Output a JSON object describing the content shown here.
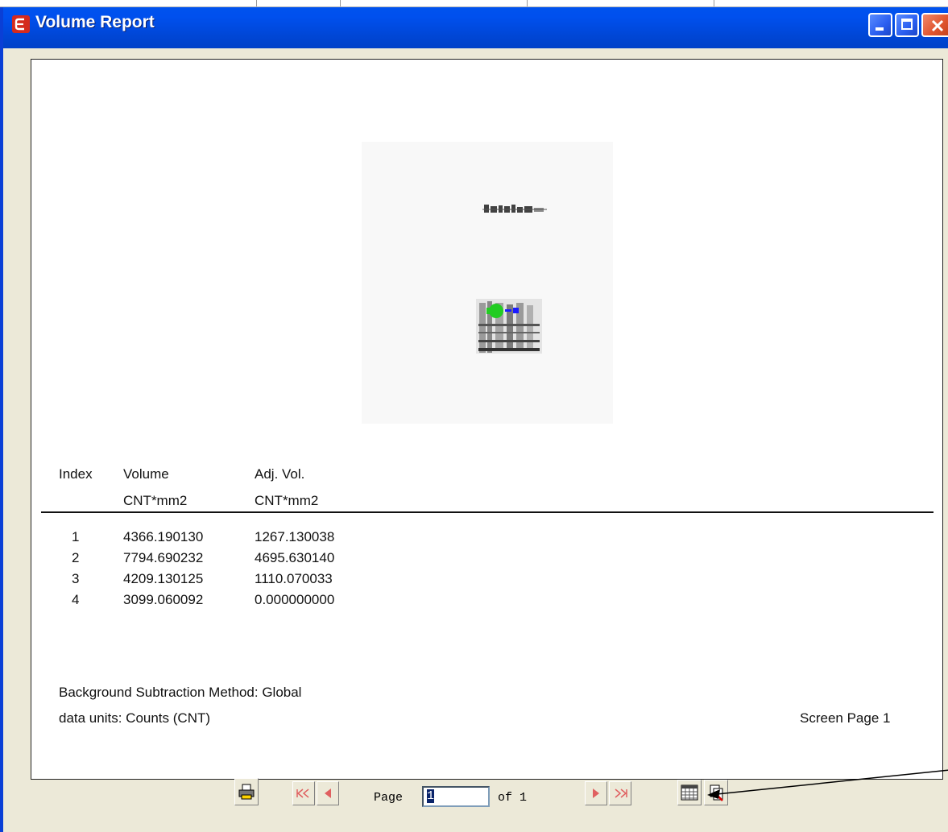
{
  "window": {
    "title": "Volume Report"
  },
  "report": {
    "headers": {
      "index": "Index",
      "volume": "Volume",
      "volume_unit": "CNT*mm2",
      "adj_vol": "Adj. Vol.",
      "adj_vol_unit": "CNT*mm2"
    },
    "rows": [
      {
        "index": "1",
        "volume": "4366.190130",
        "adj_vol": "1267.130038"
      },
      {
        "index": "2",
        "volume": "7794.690232",
        "adj_vol": "4695.630140"
      },
      {
        "index": "3",
        "volume": "4209.130125",
        "adj_vol": "1110.070033"
      },
      {
        "index": "4",
        "volume": "3099.060092",
        "adj_vol": "0.000000000"
      }
    ],
    "background_method": "Background Subtraction Method:  Global",
    "data_units": "data units: Counts  (CNT)",
    "screen_page": "Screen Page 1"
  },
  "toolbar": {
    "page_label": "Page",
    "page_value": "1",
    "of_label": "of 1",
    "icons": [
      "print-icon",
      "first-page-icon",
      "previous-page-icon",
      "next-page-icon",
      "last-page-icon",
      "spreadsheet-export-icon",
      "copy-export-icon"
    ]
  },
  "colors": {
    "title_bar": "#0050ee",
    "close_button": "#e0542e",
    "marker_green": "#22cc22",
    "marker_blue": "#1a1aff"
  }
}
